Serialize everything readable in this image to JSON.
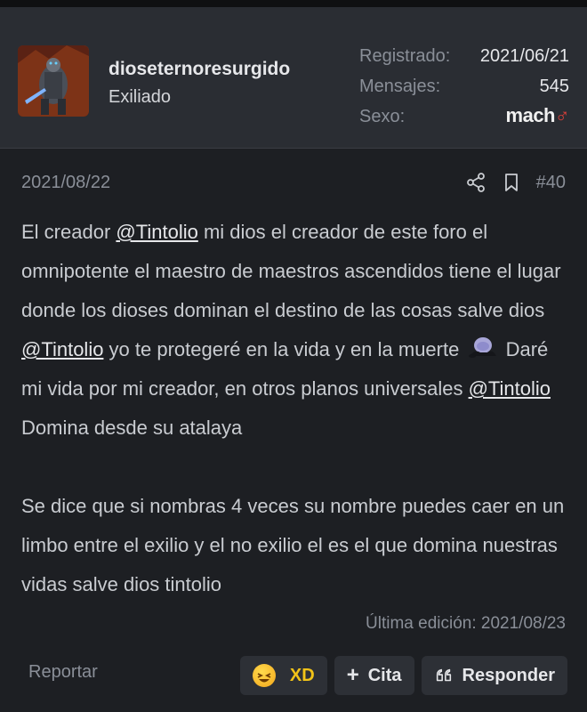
{
  "user": {
    "username": "dioseternoresurgido",
    "title": "Exiliado",
    "stats": {
      "registered_label": "Registrado:",
      "registered_value": "2021/06/21",
      "posts_label": "Mensajes:",
      "posts_value": "545",
      "gender_label": "Sexo:",
      "gender_value": "mach",
      "gender_symbol": "♂"
    }
  },
  "post": {
    "date": "2021/08/22",
    "number": "#40",
    "icons": [
      "share-icon",
      "bookmark-icon"
    ],
    "body": {
      "p1_a": "El creador ",
      "mention": "@Tintolio",
      "p1_b": " mi dios el creador de este foro el omnipotente el maestro de maestros ascendidos tiene el lugar donde los dioses dominan el destino de las cosas salve dios ",
      "p1_c": " yo te protegeré en la vida y en la muerte ",
      "p1_d": " Daré mi vida por mi creador, en otros planos universales ",
      "p1_e": " Domina desde su atalaya",
      "p2": "Se dice que si nombras 4 veces su nombre puedes caer en un limbo entre el exilio y el no exilio el es el que domina nuestras vidas salve dios tintolio"
    },
    "edited": "Última edición: 2021/08/23",
    "report_label": "Reportar",
    "actions": {
      "xd_label": "XD",
      "quote_label": "Cita",
      "reply_label": "Responder"
    }
  },
  "colors": {
    "background": "#1d1f23",
    "header_bg": "#2a2d33",
    "muted": "#8a8f98",
    "xd_accent": "#f2c318",
    "gender_symbol": "#e0403a"
  }
}
